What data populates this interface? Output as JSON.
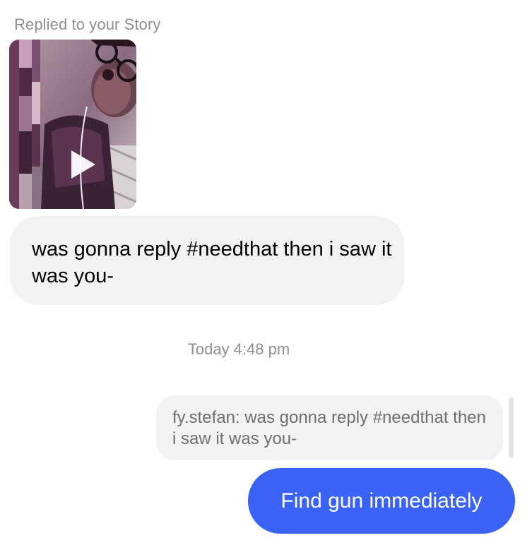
{
  "story_reply": {
    "label": "Replied to your Story",
    "thumbnail": {
      "description_icon": "play-icon",
      "play_color": "#ffffff"
    }
  },
  "messages": {
    "incoming_text": "was gonna reply #needthat then i saw it was you-",
    "timestamp": "Today 4:48 pm",
    "quoted_reply": "fy.stefan: was gonna reply #needthat then i saw it was you-",
    "outgoing_text": "Find gun immediately"
  },
  "colors": {
    "outgoing_bubble": "#3a63f5",
    "incoming_bubble": "#f2f2f2",
    "meta_text": "#8e8e93"
  }
}
